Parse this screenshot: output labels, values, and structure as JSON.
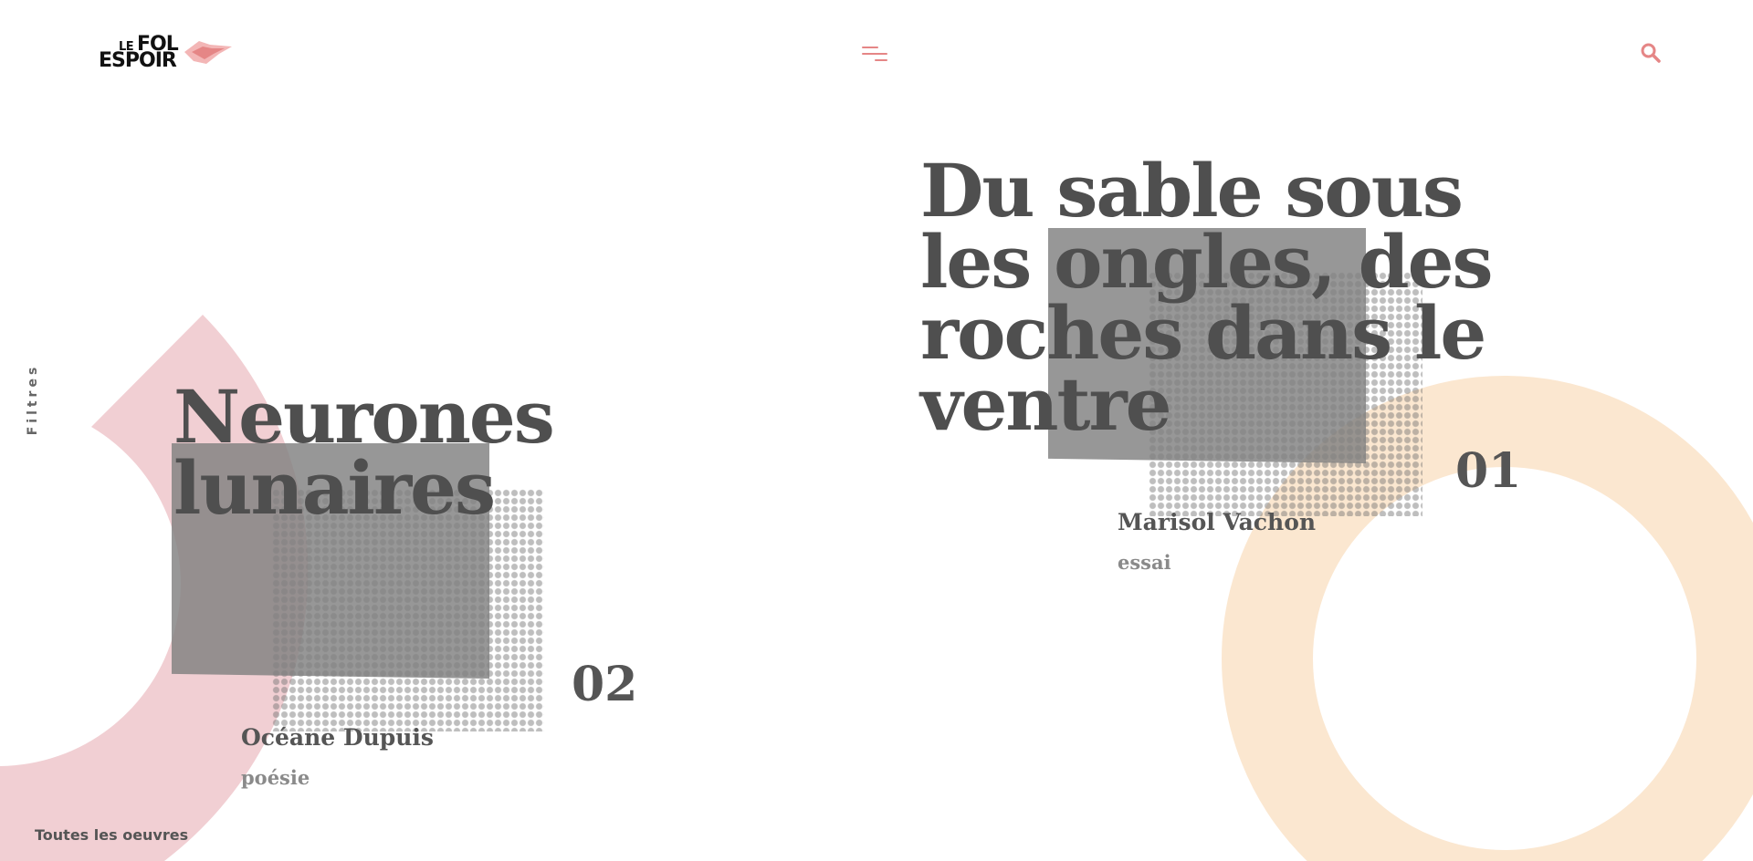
{
  "header": {
    "logo": {
      "small": "LE",
      "top": "FOL",
      "bottom": "ESPOIR"
    }
  },
  "icons": {
    "menu": "menu-icon",
    "search": "search-icon"
  },
  "sidebar": {
    "filters_label": "Filtres"
  },
  "works": [
    {
      "number": "01",
      "title_lines": [
        "Du sable sous",
        "les ongles, des",
        "roches dans le",
        "ventre"
      ],
      "author": "Marisol Vachon",
      "genre": "essai"
    },
    {
      "number": "02",
      "title_lines": [
        "Neurones",
        "lunaires"
      ],
      "author": "Océane Dupuis",
      "genre": "poésie"
    }
  ],
  "footer": {
    "all_works_label": "Toutes les oeuvres"
  },
  "colors": {
    "accent": "#e58686",
    "pink_shape": "#f1cfd3",
    "peach_ring": "#fbe7d0",
    "title_gray": "#4f4f4f"
  }
}
